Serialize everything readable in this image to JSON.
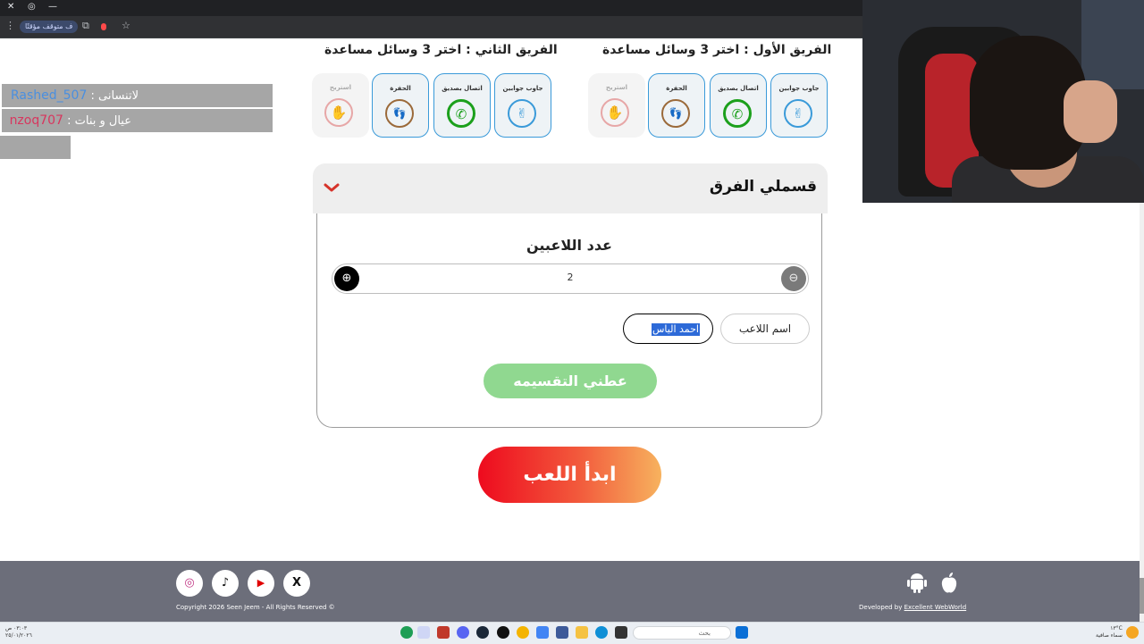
{
  "browser": {
    "paused_label": "ف متوقف مؤقتًا",
    "window_controls": [
      "✕",
      "◎",
      "—"
    ]
  },
  "ticker": [
    {
      "label": "لاتنسانى :",
      "name": "Rashed_507",
      "name_color": "#4a8fe0"
    },
    {
      "label": "عيال و بنات :",
      "name": "nzoq707",
      "name_color": "#d8365e"
    }
  ],
  "team1": {
    "title": "الفريق الأول : اختر 3 وسائل مساعدة",
    "lifelines": [
      {
        "label": "جاوب جوابين",
        "icon": "peace-hand-icon",
        "color": "blue",
        "glyph": "✌"
      },
      {
        "label": "اتصال بصديق",
        "icon": "phone-icon",
        "color": "green",
        "glyph": "✆"
      },
      {
        "label": "الحفرة",
        "icon": "footprints-icon",
        "color": "brown",
        "glyph": "👣"
      },
      {
        "label": "استريح",
        "icon": "stop-hand-icon",
        "color": "pink",
        "glyph": "✋"
      }
    ]
  },
  "team2": {
    "title": "الفريق الثاني : اختر 3 وسائل مساعدة",
    "lifelines": [
      {
        "label": "جاوب جوابين",
        "icon": "peace-hand-icon",
        "color": "blue",
        "glyph": "✌"
      },
      {
        "label": "اتصال بصديق",
        "icon": "phone-icon",
        "color": "green",
        "glyph": "✆"
      },
      {
        "label": "الحفرة",
        "icon": "footprints-icon",
        "color": "brown",
        "glyph": "👣"
      },
      {
        "label": "استريح",
        "icon": "stop-hand-icon",
        "color": "pink",
        "glyph": "✋"
      }
    ]
  },
  "accordion": {
    "title": "قسملي الفرق",
    "player_count_title": "عدد اللاعبين",
    "player_count": "2",
    "player_name_label": "اسم اللاعب",
    "player_name_value": "احمد الياس",
    "split_button": "عطني التقسيمه"
  },
  "play_button": "ابدأ اللعب",
  "footer": {
    "copyright": "Copyright 2026 Seen Jeem - All Rights Reserved ©",
    "developed_by": "Developed by",
    "developer": "Excellent WebWorld",
    "social": [
      {
        "icon": "instagram-icon",
        "glyph": "◎",
        "color": "#c13584"
      },
      {
        "icon": "tiktok-icon",
        "glyph": "♪",
        "color": "#111111"
      },
      {
        "icon": "youtube-icon",
        "glyph": "▶",
        "color": "#e00000"
      },
      {
        "icon": "x-icon",
        "glyph": "X",
        "color": "#111111"
      }
    ]
  },
  "taskbar": {
    "search_placeholder": "بحث",
    "clock_time": "٠٣:٠٣ ص",
    "clock_date": "٢٥/٠١/٢٠٢٦",
    "weather_temp": "١٣°C",
    "weather_text": "سماء صافية"
  },
  "colors": {
    "accent_blue": "#3a9ad9",
    "green": "#1ca01c",
    "split_button_bg": "#90d890",
    "play_gradient_start": "#ee0a1e",
    "play_gradient_end": "#f7b25e",
    "footer_bg": "#6c6e7a"
  }
}
